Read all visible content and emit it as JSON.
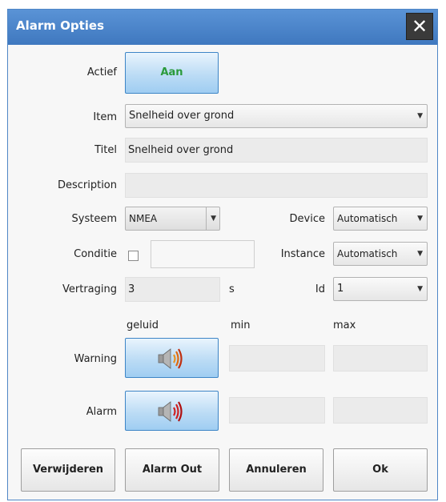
{
  "window": {
    "title": "Alarm Opties",
    "close_glyph": "✕"
  },
  "actief": {
    "label": "Actief",
    "button_label": "Aan"
  },
  "item": {
    "label": "Item",
    "value": "Snelheid over grond"
  },
  "titel": {
    "label": "Titel",
    "value": "Snelheid over grond"
  },
  "description": {
    "label": "Description",
    "value": ""
  },
  "systeem": {
    "label": "Systeem",
    "value": "NMEA"
  },
  "device": {
    "label": "Device",
    "value": "Automatisch"
  },
  "conditie": {
    "label": "Conditie",
    "checked": false,
    "value": ""
  },
  "instance": {
    "label": "Instance",
    "value": "Automatisch"
  },
  "vertraging": {
    "label": "Vertraging",
    "value": "3",
    "unit": "s"
  },
  "id": {
    "label": "Id",
    "value": "1"
  },
  "columns": {
    "geluid": "geluid",
    "min": "min",
    "max": "max"
  },
  "warning": {
    "label": "Warning",
    "min": "",
    "max": ""
  },
  "alarm": {
    "label": "Alarm",
    "min": "",
    "max": ""
  },
  "footer": {
    "delete_label": "Verwijderen",
    "alarm_out_label": "Alarm Out",
    "cancel_label": "Annuleren",
    "ok_label": "Ok"
  },
  "colors": {
    "titlebar": "#4a86cc",
    "accent_green": "#2a9a3a",
    "speaker_red": "#d02020",
    "speaker_orange": "#e89020"
  },
  "icons": {
    "close": "close-icon",
    "speaker": "speaker-icon",
    "dropdown": "chevron-down-icon"
  }
}
